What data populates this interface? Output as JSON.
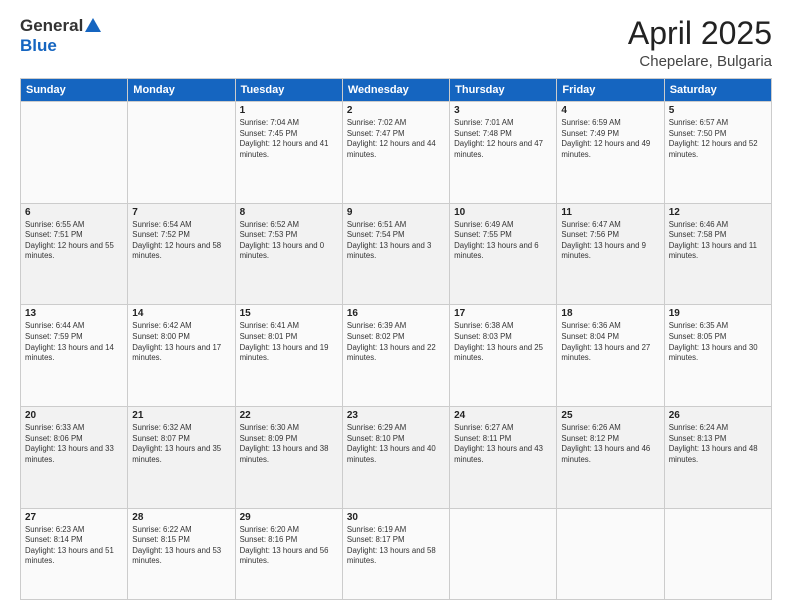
{
  "header": {
    "logo": {
      "general": "General",
      "blue": "Blue"
    },
    "title": "April 2025",
    "subtitle": "Chepelare, Bulgaria"
  },
  "weekdays": [
    "Sunday",
    "Monday",
    "Tuesday",
    "Wednesday",
    "Thursday",
    "Friday",
    "Saturday"
  ],
  "weeks": [
    [
      {
        "day": "",
        "sunrise": "",
        "sunset": "",
        "daylight": ""
      },
      {
        "day": "",
        "sunrise": "",
        "sunset": "",
        "daylight": ""
      },
      {
        "day": "1",
        "sunrise": "Sunrise: 7:04 AM",
        "sunset": "Sunset: 7:45 PM",
        "daylight": "Daylight: 12 hours and 41 minutes."
      },
      {
        "day": "2",
        "sunrise": "Sunrise: 7:02 AM",
        "sunset": "Sunset: 7:47 PM",
        "daylight": "Daylight: 12 hours and 44 minutes."
      },
      {
        "day": "3",
        "sunrise": "Sunrise: 7:01 AM",
        "sunset": "Sunset: 7:48 PM",
        "daylight": "Daylight: 12 hours and 47 minutes."
      },
      {
        "day": "4",
        "sunrise": "Sunrise: 6:59 AM",
        "sunset": "Sunset: 7:49 PM",
        "daylight": "Daylight: 12 hours and 49 minutes."
      },
      {
        "day": "5",
        "sunrise": "Sunrise: 6:57 AM",
        "sunset": "Sunset: 7:50 PM",
        "daylight": "Daylight: 12 hours and 52 minutes."
      }
    ],
    [
      {
        "day": "6",
        "sunrise": "Sunrise: 6:55 AM",
        "sunset": "Sunset: 7:51 PM",
        "daylight": "Daylight: 12 hours and 55 minutes."
      },
      {
        "day": "7",
        "sunrise": "Sunrise: 6:54 AM",
        "sunset": "Sunset: 7:52 PM",
        "daylight": "Daylight: 12 hours and 58 minutes."
      },
      {
        "day": "8",
        "sunrise": "Sunrise: 6:52 AM",
        "sunset": "Sunset: 7:53 PM",
        "daylight": "Daylight: 13 hours and 0 minutes."
      },
      {
        "day": "9",
        "sunrise": "Sunrise: 6:51 AM",
        "sunset": "Sunset: 7:54 PM",
        "daylight": "Daylight: 13 hours and 3 minutes."
      },
      {
        "day": "10",
        "sunrise": "Sunrise: 6:49 AM",
        "sunset": "Sunset: 7:55 PM",
        "daylight": "Daylight: 13 hours and 6 minutes."
      },
      {
        "day": "11",
        "sunrise": "Sunrise: 6:47 AM",
        "sunset": "Sunset: 7:56 PM",
        "daylight": "Daylight: 13 hours and 9 minutes."
      },
      {
        "day": "12",
        "sunrise": "Sunrise: 6:46 AM",
        "sunset": "Sunset: 7:58 PM",
        "daylight": "Daylight: 13 hours and 11 minutes."
      }
    ],
    [
      {
        "day": "13",
        "sunrise": "Sunrise: 6:44 AM",
        "sunset": "Sunset: 7:59 PM",
        "daylight": "Daylight: 13 hours and 14 minutes."
      },
      {
        "day": "14",
        "sunrise": "Sunrise: 6:42 AM",
        "sunset": "Sunset: 8:00 PM",
        "daylight": "Daylight: 13 hours and 17 minutes."
      },
      {
        "day": "15",
        "sunrise": "Sunrise: 6:41 AM",
        "sunset": "Sunset: 8:01 PM",
        "daylight": "Daylight: 13 hours and 19 minutes."
      },
      {
        "day": "16",
        "sunrise": "Sunrise: 6:39 AM",
        "sunset": "Sunset: 8:02 PM",
        "daylight": "Daylight: 13 hours and 22 minutes."
      },
      {
        "day": "17",
        "sunrise": "Sunrise: 6:38 AM",
        "sunset": "Sunset: 8:03 PM",
        "daylight": "Daylight: 13 hours and 25 minutes."
      },
      {
        "day": "18",
        "sunrise": "Sunrise: 6:36 AM",
        "sunset": "Sunset: 8:04 PM",
        "daylight": "Daylight: 13 hours and 27 minutes."
      },
      {
        "day": "19",
        "sunrise": "Sunrise: 6:35 AM",
        "sunset": "Sunset: 8:05 PM",
        "daylight": "Daylight: 13 hours and 30 minutes."
      }
    ],
    [
      {
        "day": "20",
        "sunrise": "Sunrise: 6:33 AM",
        "sunset": "Sunset: 8:06 PM",
        "daylight": "Daylight: 13 hours and 33 minutes."
      },
      {
        "day": "21",
        "sunrise": "Sunrise: 6:32 AM",
        "sunset": "Sunset: 8:07 PM",
        "daylight": "Daylight: 13 hours and 35 minutes."
      },
      {
        "day": "22",
        "sunrise": "Sunrise: 6:30 AM",
        "sunset": "Sunset: 8:09 PM",
        "daylight": "Daylight: 13 hours and 38 minutes."
      },
      {
        "day": "23",
        "sunrise": "Sunrise: 6:29 AM",
        "sunset": "Sunset: 8:10 PM",
        "daylight": "Daylight: 13 hours and 40 minutes."
      },
      {
        "day": "24",
        "sunrise": "Sunrise: 6:27 AM",
        "sunset": "Sunset: 8:11 PM",
        "daylight": "Daylight: 13 hours and 43 minutes."
      },
      {
        "day": "25",
        "sunrise": "Sunrise: 6:26 AM",
        "sunset": "Sunset: 8:12 PM",
        "daylight": "Daylight: 13 hours and 46 minutes."
      },
      {
        "day": "26",
        "sunrise": "Sunrise: 6:24 AM",
        "sunset": "Sunset: 8:13 PM",
        "daylight": "Daylight: 13 hours and 48 minutes."
      }
    ],
    [
      {
        "day": "27",
        "sunrise": "Sunrise: 6:23 AM",
        "sunset": "Sunset: 8:14 PM",
        "daylight": "Daylight: 13 hours and 51 minutes."
      },
      {
        "day": "28",
        "sunrise": "Sunrise: 6:22 AM",
        "sunset": "Sunset: 8:15 PM",
        "daylight": "Daylight: 13 hours and 53 minutes."
      },
      {
        "day": "29",
        "sunrise": "Sunrise: 6:20 AM",
        "sunset": "Sunset: 8:16 PM",
        "daylight": "Daylight: 13 hours and 56 minutes."
      },
      {
        "day": "30",
        "sunrise": "Sunrise: 6:19 AM",
        "sunset": "Sunset: 8:17 PM",
        "daylight": "Daylight: 13 hours and 58 minutes."
      },
      {
        "day": "",
        "sunrise": "",
        "sunset": "",
        "daylight": ""
      },
      {
        "day": "",
        "sunrise": "",
        "sunset": "",
        "daylight": ""
      },
      {
        "day": "",
        "sunrise": "",
        "sunset": "",
        "daylight": ""
      }
    ]
  ]
}
